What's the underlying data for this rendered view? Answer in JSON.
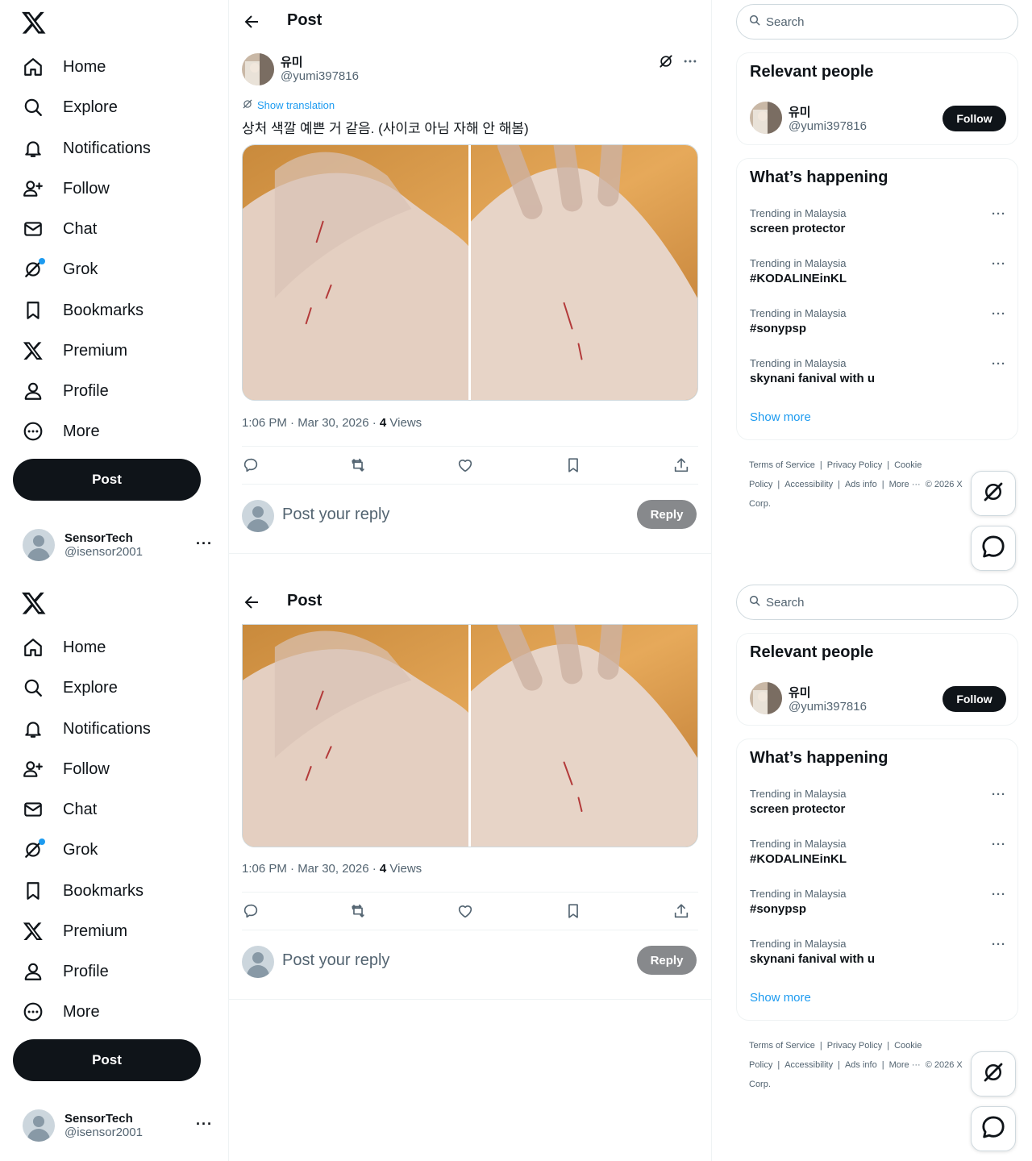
{
  "nav": {
    "items": [
      {
        "label": "Home"
      },
      {
        "label": "Explore"
      },
      {
        "label": "Notifications"
      },
      {
        "label": "Follow"
      },
      {
        "label": "Chat"
      },
      {
        "label": "Grok"
      },
      {
        "label": "Bookmarks"
      },
      {
        "label": "Premium"
      },
      {
        "label": "Profile"
      },
      {
        "label": "More"
      }
    ],
    "post_button": "Post"
  },
  "account": {
    "name": "SensorTech",
    "handle": "@isensor2001",
    "more": "···"
  },
  "header": {
    "title": "Post"
  },
  "post": {
    "author_name": "유미",
    "author_handle": "@yumi397816",
    "show_translation": "Show translation",
    "text": "상처 색깔 예쁜 거 같음. (사이코 아님 자해 안 해봄)",
    "time": "1:06 PM · Mar 30, 2026 · ",
    "views_count": "4",
    "views_label": " Views"
  },
  "reply": {
    "placeholder": "Post your reply",
    "button": "Reply"
  },
  "search": {
    "placeholder": "Search"
  },
  "relevant_people": {
    "title": "Relevant people",
    "person_name": "유미",
    "person_handle": "@yumi397816",
    "follow": "Follow"
  },
  "whats_happening": {
    "title": "What’s happening",
    "trends": [
      {
        "category": "Trending in Malaysia",
        "name": "screen protector"
      },
      {
        "category": "Trending in Malaysia",
        "name": "#KODALINEinKL"
      },
      {
        "category": "Trending in Malaysia",
        "name": "#sonypsp"
      },
      {
        "category": "Trending in Malaysia",
        "name": "skynani fanival with u"
      }
    ],
    "more_glyph": "···",
    "show_more": "Show more"
  },
  "footer": {
    "links": [
      "Terms of Service",
      "|",
      "Privacy Policy",
      "|",
      "Cookie Policy",
      "|",
      "Accessibility",
      "|",
      "Ads info",
      "|",
      "More ···",
      "© 2026 X Corp."
    ]
  },
  "colors": {
    "accent": "#1d9bf0",
    "text": "#0f1419",
    "muted": "#536471"
  },
  "icons": {
    "nav": [
      "home-icon",
      "explore-icon",
      "notifications-icon",
      "follow-icon",
      "chat-icon",
      "grok-icon",
      "bookmarks-icon",
      "premium-icon",
      "profile-icon",
      "more-icon"
    ],
    "actions": [
      "reply-icon",
      "repost-icon",
      "like-icon",
      "bookmark-icon",
      "share-icon"
    ]
  }
}
